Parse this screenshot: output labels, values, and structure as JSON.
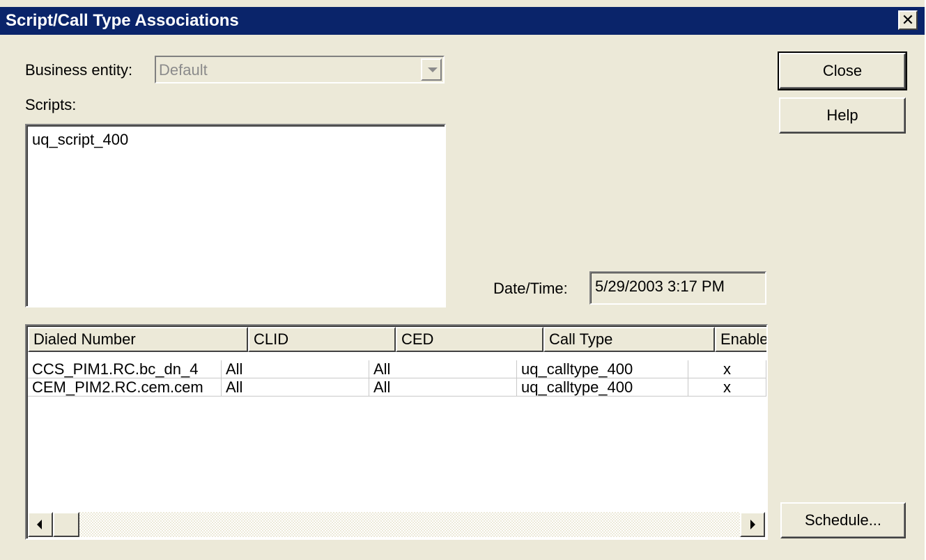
{
  "window": {
    "title": "Script/Call Type Associations",
    "close_glyph": "✕",
    "icons": {
      "close": "close-icon",
      "combo": "chevron-down-icon",
      "scroll_left": "arrow-left-icon",
      "scroll_right": "arrow-right-icon"
    }
  },
  "form": {
    "business_entity_label": "Business entity:",
    "business_entity_value": "Default",
    "scripts_label": "Scripts:",
    "scripts": [
      "uq_script_400"
    ],
    "datetime_label": "Date/Time:",
    "datetime_value": "5/29/2003 3:17 PM"
  },
  "buttons": {
    "close": "Close",
    "help": "Help",
    "schedule": "Schedule..."
  },
  "table": {
    "columns": [
      "Dialed Number",
      "CLID",
      "CED",
      "Call Type",
      "Enabled"
    ],
    "rows": [
      [
        "CCS_PIM1.RC.bc_dn_4",
        "All",
        "All",
        "uq_calltype_400",
        "x"
      ],
      [
        "CEM_PIM2.RC.cem.cem",
        "All",
        "All",
        "uq_calltype_400",
        "x"
      ]
    ]
  }
}
